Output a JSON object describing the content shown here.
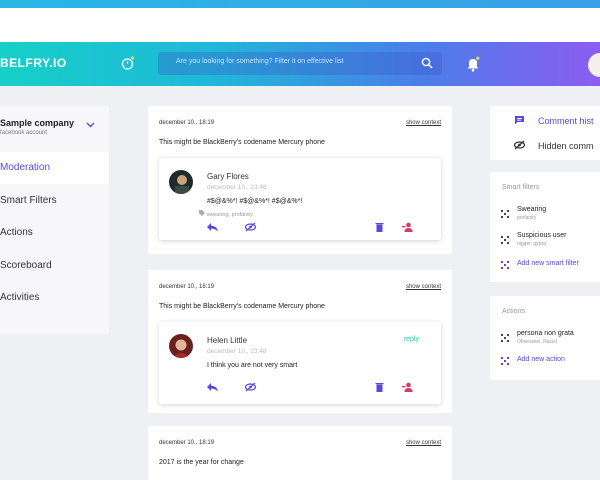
{
  "header": {
    "logo": "BELFRY.IO",
    "search_placeholder": "Are you looking for something? Filter it on effective list",
    "icons": {
      "timer": "stopwatch-icon",
      "search": "search-icon",
      "bell": "bell-icon"
    }
  },
  "sidebar": {
    "company_name": "Sample company",
    "company_sub": "facebook account",
    "items": [
      {
        "label": "Moderation",
        "active": true
      },
      {
        "label": "Smart Filters",
        "active": false
      },
      {
        "label": "Actions",
        "active": false
      },
      {
        "label": "Scoreboard",
        "active": false
      },
      {
        "label": "Activities",
        "active": false
      }
    ]
  },
  "posts": [
    {
      "date": "december 10., 18:19",
      "link": "show context",
      "text": "This might be BlackBerry's codename Mercury phone",
      "comment": {
        "name": "Gary Flores",
        "date": "december 10., 23:48",
        "text": "#$@&%*! #$@&%*! #$@&%*!",
        "tags": "swearing, profanity",
        "reply": ""
      }
    },
    {
      "date": "december 10., 18:19",
      "link": "show context",
      "text": "This might be BlackBerry's codename Mercury phone",
      "comment": {
        "name": "Helen Little",
        "date": "december 10., 23:48",
        "text": "I think you are not very smart",
        "tags": "",
        "reply": "reply"
      }
    },
    {
      "date": "december 10., 18:19",
      "link": "show context",
      "text": "2017 is the year for change"
    }
  ],
  "right": {
    "comment_history": "Comment hist",
    "hidden_comments": "Hidden comm",
    "smart_filters": {
      "title": "Smart filters",
      "items": [
        {
          "name": "Swearing",
          "sub": "profanity"
        },
        {
          "name": "Suspicious user",
          "sub": "nigger, gypsy"
        }
      ],
      "add": "Add new smart filter"
    },
    "actions": {
      "title": "Actions",
      "items": [
        {
          "name": "persona non grata",
          "sub": "Obsessive, Racist"
        }
      ],
      "add": "Add new action"
    }
  },
  "colors": {
    "accent": "#5b48d9",
    "teal": "#2ec9b0",
    "header_start": "#16d0c8",
    "header_end": "#8d5cf0"
  }
}
